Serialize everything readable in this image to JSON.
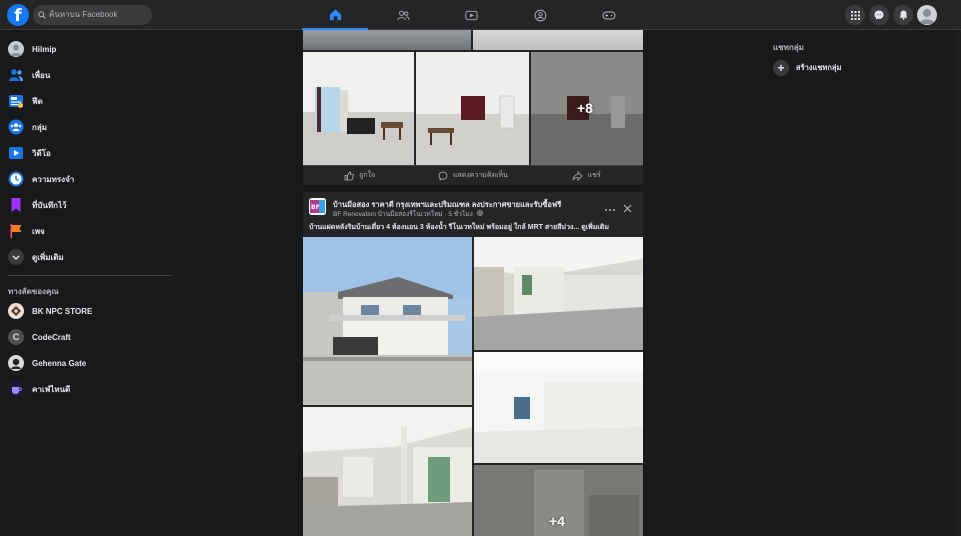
{
  "topbar": {
    "logo": "f",
    "search_placeholder": "ค้นหาบน Facebook",
    "nav_icons": [
      "home-icon",
      "friends-icon",
      "watch-icon",
      "groups-icon",
      "gaming-icon"
    ],
    "right_icons": [
      "menu-grid-icon",
      "messenger-icon",
      "notifications-icon",
      "profile-avatar"
    ]
  },
  "sidebar": {
    "items": [
      {
        "label": "Hilmip",
        "icon": "avatar",
        "color": "#c9ccd1"
      },
      {
        "label": "เพื่อน",
        "icon": "friends-icon",
        "color": "#1b74e4"
      },
      {
        "label": "ฟีด",
        "icon": "feed-icon",
        "color": "#1b74e4"
      },
      {
        "label": "กลุ่ม",
        "icon": "groups-icon",
        "color": "#1b74e4"
      },
      {
        "label": "วิดีโอ",
        "icon": "video-icon",
        "color": "#1b74e4"
      },
      {
        "label": "ความทรงจำ",
        "icon": "memories-icon",
        "color": "#1b74e4"
      },
      {
        "label": "ที่บันทึกไว้",
        "icon": "saved-icon",
        "color": "#a033ff"
      },
      {
        "label": "เพจ",
        "icon": "pages-icon",
        "color": "#f35369"
      },
      {
        "label": "ดูเพิ่มเติม",
        "icon": "chevron-down-icon",
        "color": "#3a3b3c"
      }
    ],
    "shortcuts_title": "ทางลัดของคุณ",
    "shortcuts": [
      {
        "label": "BK NPC STORE",
        "icon": "bk-npc-store-logo"
      },
      {
        "label": "CodeCraft",
        "icon": "codecraft-logo"
      },
      {
        "label": "Gehenna Gate",
        "icon": "gehenna-gate-logo"
      },
      {
        "label": "คาเฟ่ไหนดี",
        "icon": "cafe-logo"
      }
    ]
  },
  "post1": {
    "more_photos": "+8",
    "actions": [
      {
        "label": "ถูกใจ",
        "icon": "like-icon"
      },
      {
        "label": "แสดงความคิดเห็น",
        "icon": "comment-icon"
      },
      {
        "label": "แชร์",
        "icon": "share-icon"
      }
    ]
  },
  "post2": {
    "page_name": "บ้านมือสอง ราคาดี กรุงเทพฯและปริมณฑล ลงประกาศขายและรับซื้อฟรี",
    "author": "BF Renovation บ้านมือสองรีโนเวทใหม่",
    "time": "5 ชั่วโมง",
    "text": "บ้านแฝดหลังริมบ้านเดี่ยว 4 ห้องนอน 3 ห้องน้ำ รีโนเวทใหม่ พร้อมอยู่ ใกล้ MRT สายสีม่วง... ดูเพิ่มเติม",
    "more_photos": "+4"
  },
  "rightcol": {
    "chat_title": "แชทกลุ่ม",
    "create_group": "สร้างแชทกลุ่ม"
  }
}
